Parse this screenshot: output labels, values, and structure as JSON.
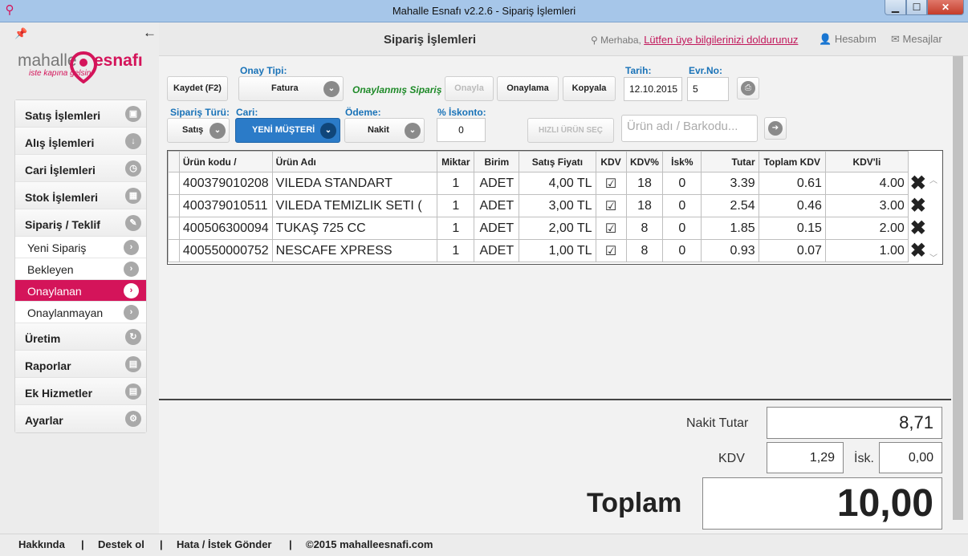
{
  "window": {
    "title": "Mahalle Esnafı v2.2.6 - Sipariş İşlemleri",
    "min": "▁",
    "max": "☐",
    "close": "✕"
  },
  "brand": {
    "word1": "mahalle",
    "word2": "esnafı",
    "tagline": "iste kapına gelsin!",
    "color": "#d4145a"
  },
  "sidebar": {
    "items": [
      {
        "label": "Satış İşlemleri",
        "icon": "shopping-bag-icon",
        "glyph": "▣"
      },
      {
        "label": "Alış İşlemleri",
        "icon": "download-icon",
        "glyph": "↓"
      },
      {
        "label": "Cari İşlemleri",
        "icon": "clock-icon",
        "glyph": "◷"
      },
      {
        "label": "Stok İşlemleri",
        "icon": "grid-icon",
        "glyph": "▦"
      },
      {
        "label": "Sipariş / Teklif",
        "icon": "pencil-icon",
        "glyph": "✎"
      }
    ],
    "subitems": [
      {
        "label": "Yeni Sipariş",
        "active": false
      },
      {
        "label": "Bekleyen",
        "active": false
      },
      {
        "label": "Onaylanan",
        "active": true
      },
      {
        "label": "Onaylanmayan",
        "active": false
      }
    ],
    "items2": [
      {
        "label": "Üretim",
        "icon": "refresh-icon",
        "glyph": "↻"
      },
      {
        "label": "Raporlar",
        "icon": "calendar-icon",
        "glyph": "▤"
      },
      {
        "label": "Ek Hizmetler",
        "icon": "calendar-icon",
        "glyph": "▤"
      },
      {
        "label": "Ayarlar",
        "icon": "gear-icon",
        "glyph": "⚙"
      }
    ]
  },
  "header": {
    "title": "Sipariş İşlemleri",
    "greeting": "Merhaba,",
    "profile_link": "Lütfen üye bilgilerinizi doldurunuz",
    "account": "Hesabım",
    "messages": "Mesajlar"
  },
  "toolbar": {
    "save": "Kaydet (F2)",
    "onay_tipi_label": "Onay Tipi:",
    "onay_tipi_value": "Fatura",
    "status": "Onaylanmış Sipariş",
    "approve": "Onayla",
    "reject": "Onaylama",
    "copy": "Kopyala",
    "date_label": "Tarih:",
    "date_value": "12.10.2015",
    "doc_label": "Evr.No:",
    "doc_value": "5",
    "order_type_label": "Sipariş Türü:",
    "order_type_value": "Satış",
    "cari_label": "Cari:",
    "cari_value": "YENİ MÜŞTERİ",
    "payment_label": "Ödeme:",
    "payment_value": "Nakit",
    "discount_label": "% İskonto:",
    "discount_value": "0",
    "quick_select": "HIZLI ÜRÜN SEÇ",
    "search_placeholder": "Ürün adı / Barkodu..."
  },
  "table": {
    "headers": [
      "Ürün kodu /",
      "Ürün Adı",
      "Miktar",
      "Birim",
      "Satış Fiyatı",
      "KDV",
      "KDV%",
      "İsk%",
      "Tutar",
      "Toplam KDV",
      "KDV'li"
    ],
    "rows": [
      [
        "400379010208",
        "VILEDA STANDART",
        "1",
        "ADET",
        "4,00 TL",
        "☑",
        "18",
        "0",
        "3.39",
        "0.61",
        "4.00"
      ],
      [
        "400379010511",
        "VILEDA TEMIZLIK SETI (",
        "1",
        "ADET",
        "3,00 TL",
        "☑",
        "18",
        "0",
        "2.54",
        "0.46",
        "3.00"
      ],
      [
        "400506300094",
        "TUKAŞ 725 CC",
        "1",
        "ADET",
        "2,00 TL",
        "☑",
        "8",
        "0",
        "1.85",
        "0.15",
        "2.00"
      ],
      [
        "400550000752",
        "NESCAFE XPRESS",
        "1",
        "ADET",
        "1,00 TL",
        "☑",
        "8",
        "0",
        "0.93",
        "0.07",
        "1.00"
      ]
    ],
    "delete_glyph": "✖"
  },
  "summary": {
    "cash_label": "Nakit Tutar",
    "cash_value": "8,71",
    "vat_label": "KDV",
    "vat_value": "1,29",
    "disc_label": "İsk.",
    "disc_value": "0,00",
    "total_label": "Toplam",
    "total_value": "10,00"
  },
  "footer": {
    "about": "Hakkında",
    "support": "Destek ol",
    "feedback": "Hata / İstek Gönder",
    "copyright": "©2015 mahalleesnafi.com",
    "sep": "|"
  }
}
